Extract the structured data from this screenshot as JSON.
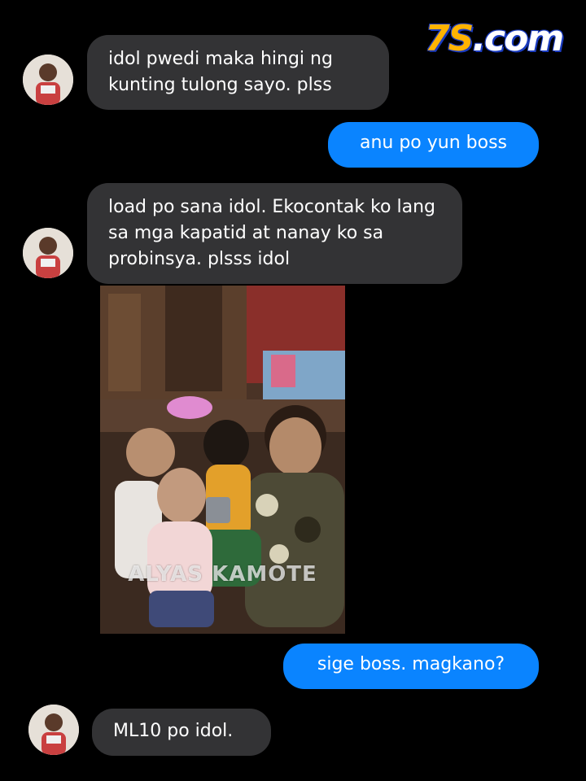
{
  "brand": {
    "logo_main": "7S",
    "logo_domain": ".com"
  },
  "conversation": {
    "messages": [
      {
        "type": "received",
        "text": "idol pwedi maka hingi ng kunting tulong sayo. plss"
      },
      {
        "type": "sent",
        "text": "anu po yun boss"
      },
      {
        "type": "received",
        "text": "load po sana idol. Ekocontak ko lang sa mga kapatid at nanay ko sa probinsya. plsss idol"
      },
      {
        "type": "received_image",
        "watermark": "ALYAS KAMOTE"
      },
      {
        "type": "sent",
        "text": "sige boss. magkano?"
      },
      {
        "type": "received",
        "text": "ML10 po idol."
      }
    ]
  },
  "colors": {
    "background": "#000000",
    "incoming_bubble": "#333335",
    "outgoing_bubble": "#0a84ff",
    "text": "#ffffff"
  }
}
